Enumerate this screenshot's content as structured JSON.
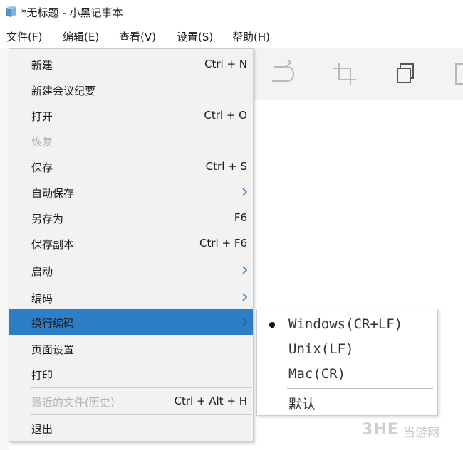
{
  "window": {
    "title": "*无标题 - 小黑记事本",
    "app_icon": "notebook-icon"
  },
  "menubar": {
    "items": [
      "文件(F)",
      "编辑(E)",
      "查看(V)",
      "设置(S)",
      "帮助(H)"
    ]
  },
  "toolbar": {
    "icons": [
      "redo-icon",
      "crop-icon",
      "copy-icon",
      "page-icon"
    ]
  },
  "file_menu": {
    "items": [
      {
        "label": "新建",
        "shortcut": "Ctrl + N"
      },
      {
        "label": "新建会议纪要",
        "shortcut": ""
      },
      {
        "label": "打开",
        "shortcut": "Ctrl + O"
      },
      {
        "label": "恢复",
        "shortcut": "",
        "disabled": true
      },
      {
        "label": "保存",
        "shortcut": "Ctrl + S"
      },
      {
        "label": "自动保存",
        "shortcut": "",
        "submenu": true
      },
      {
        "label": "另存为",
        "shortcut": "F6"
      },
      {
        "label": "保存副本",
        "shortcut": "Ctrl + F6"
      },
      {
        "label": "启动",
        "shortcut": "",
        "submenu": true
      },
      {
        "label": "编码",
        "shortcut": "",
        "submenu": true
      },
      {
        "label": "换行编码",
        "shortcut": "",
        "submenu": true,
        "highlighted": true
      },
      {
        "label": "页面设置",
        "shortcut": ""
      },
      {
        "label": "打印",
        "shortcut": ""
      },
      {
        "label": "最近的文件(历史)",
        "shortcut": "Ctrl + Alt + H",
        "disabled": true
      },
      {
        "label": "退出",
        "shortcut": ""
      }
    ]
  },
  "line_ending_submenu": {
    "items": [
      {
        "label": "Windows(CR+LF)",
        "selected": true
      },
      {
        "label": "Unix(LF)",
        "selected": false
      },
      {
        "label": "Mac(CR)",
        "selected": false
      },
      {
        "label": "默认",
        "selected": false
      }
    ]
  },
  "watermark": {
    "logo": "3HE",
    "text": "当游网"
  },
  "colors": {
    "highlight": "#2e7ec6",
    "menu_bg": "#f2f2f2",
    "disabled_text": "#b3b3b3"
  }
}
